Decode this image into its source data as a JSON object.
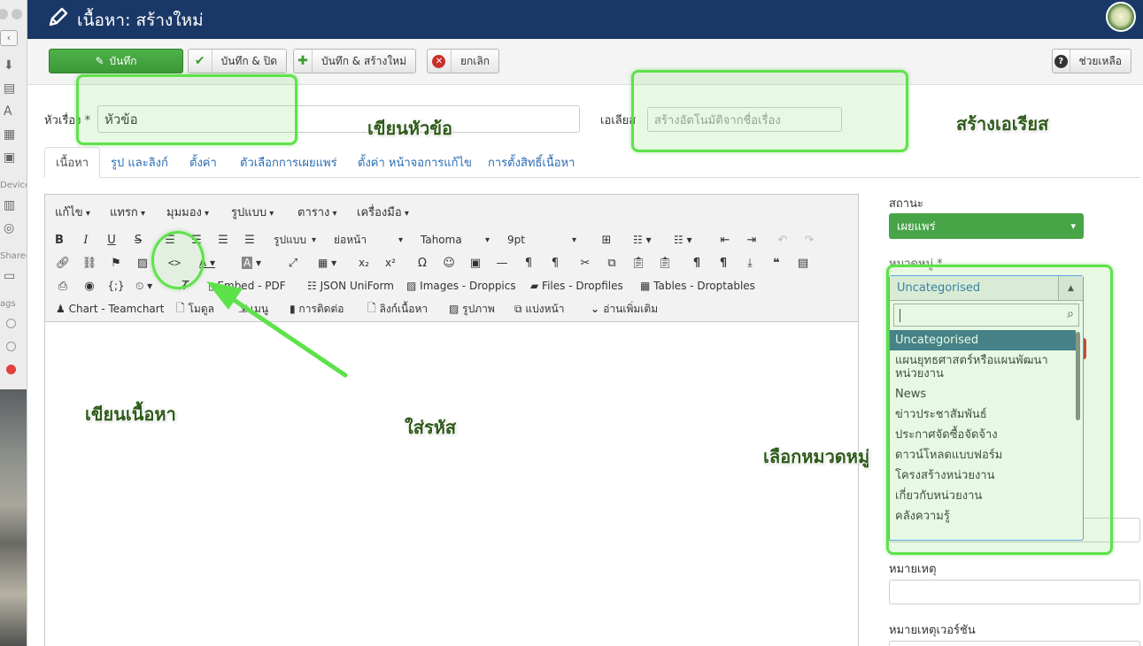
{
  "header": {
    "title": "เนื้อหา: สร้างใหม่",
    "icon": "pencil-icon",
    "logo": "org-seal"
  },
  "toolbar": {
    "save": "บันทึก",
    "save_close": "บันทึก & ปิด",
    "save_new": "บันทึก & สร้างใหม่",
    "cancel": "ยกเลิก",
    "help": "ช่วยเหลือ"
  },
  "form": {
    "title_label": "หัวเรื่อง *",
    "title_value": "หัวข้อ",
    "alias_label": "เอเลียส",
    "alias_placeholder": "สร้างอัตโนมัติจากชื่อเรื่อง"
  },
  "tabs": [
    {
      "label": "เนื้อหา",
      "active": true
    },
    {
      "label": "รูป และลิงก์"
    },
    {
      "label": "ตั้งค่า"
    },
    {
      "label": "ตัวเลือกการเผยแพร่"
    },
    {
      "label": "ตั้งค่า หน้าจอการแก้ไข"
    },
    {
      "label": "การตั้งสิทธิ์เนื้อหา"
    }
  ],
  "editor": {
    "menus": [
      "แก้ไข",
      "แทรก",
      "มุมมอง",
      "รูปแบบ",
      "ตาราง",
      "เครื่องมือ"
    ],
    "format_select": "รูปแบบ",
    "paragraph_select": "ย่อหน้า",
    "font_select": "Tahoma",
    "size_select": "9pt",
    "plugins_row3": [
      "Embed - PDF",
      "JSON UniForm",
      "Images - Droppics",
      "Files - Dropfiles",
      "Tables - Droptables"
    ],
    "plugins_row4": [
      "Chart - Teamchart",
      "โมดูล",
      "เมนู",
      "การติดต่อ",
      "ลิงก์เนื้อหา",
      "รูปภาพ",
      "แบ่งหน้า",
      "อ่านเพิ่มเติม"
    ]
  },
  "sidebar": {
    "status_label": "สถานะ",
    "status_value": "เผยแพร่",
    "status_color": "#47a447",
    "category_label": "หมวดหมู่ *",
    "category_value": "Uncategorised",
    "category_options": [
      "Uncategorised",
      "แผนยุทธศาสตร์หรือแผนพัฒนาหน่วยงาน",
      "News",
      "ข่าวประชาสัมพันธ์",
      "ประกาศจัดซื้อจัดจ้าง",
      "ดาวน์โหลดแบบฟอร์ม",
      "โครงสร้างหน่วยงาน",
      "เกี่ยวกับหน่วยงาน",
      "คลังความรู้"
    ],
    "note_label": "หมายเหตุ",
    "version_note_label": "หมายเหตุเวอร์ชัน"
  },
  "annotations": {
    "write_title": "เขียนหัวข้อ",
    "create_alias": "สร้างเอเรียส",
    "write_content": "เขียนเนื้อหา",
    "insert_code": "ใส่รหัส",
    "choose_category": "เลือกหมวดหมู่",
    "color": "#5ee24b"
  },
  "finder": {
    "labels": [
      "Device",
      "Shared",
      "ags"
    ]
  }
}
